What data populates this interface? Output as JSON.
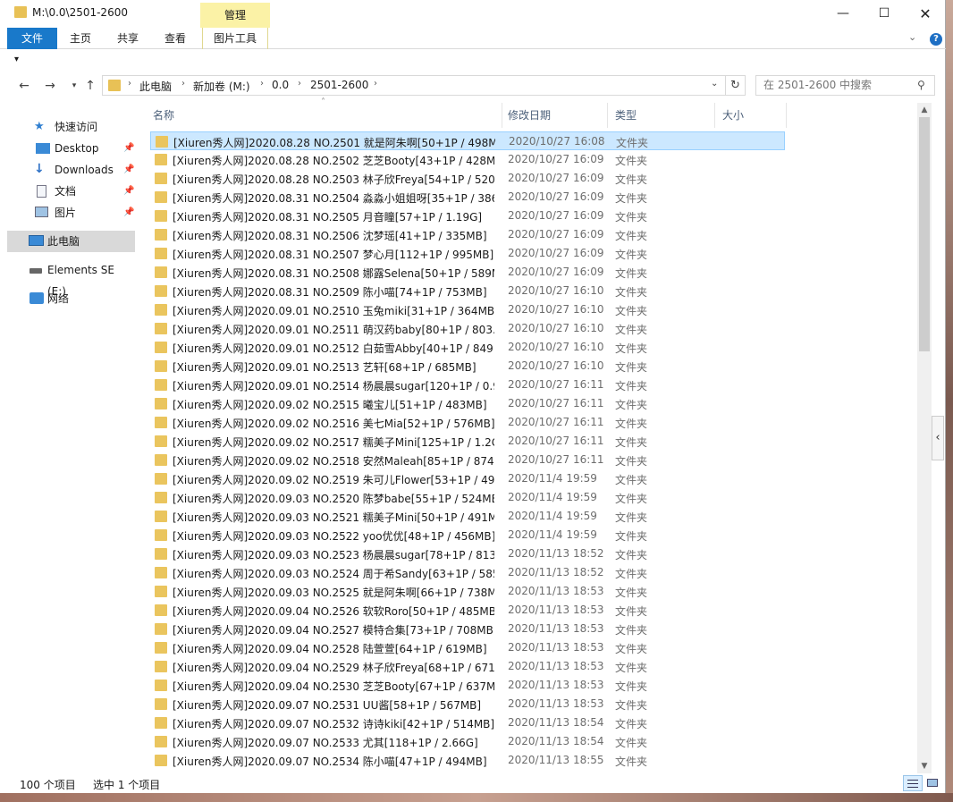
{
  "window": {
    "title": "M:\\0.0\\2501-2600",
    "context_tab": "管理",
    "controls": {
      "minimize": "—",
      "maximize": "☐",
      "close": "✕"
    }
  },
  "ribbon": {
    "tabs": [
      "文件",
      "主页",
      "共享",
      "查看",
      "图片工具"
    ],
    "help": "?",
    "accent": "#1979ca"
  },
  "address": {
    "breadcrumbs": [
      "此电脑",
      "新加卷 (M:)",
      "0.0",
      "2501-2600"
    ]
  },
  "search": {
    "placeholder": "在 2501-2600 中搜索"
  },
  "sidebar": {
    "items": [
      {
        "label": "快速访问",
        "icon": "star-icon",
        "pinned": false
      },
      {
        "label": "Desktop",
        "icon": "desktop-icon",
        "pinned": true
      },
      {
        "label": "Downloads",
        "icon": "download-icon",
        "pinned": true
      },
      {
        "label": "文档",
        "icon": "document-icon",
        "pinned": true
      },
      {
        "label": "图片",
        "icon": "picture-icon",
        "pinned": true
      },
      {
        "label": "此电脑",
        "icon": "computer-icon",
        "pinned": false
      },
      {
        "label": "Elements SE (E:)",
        "icon": "drive-icon",
        "pinned": false
      },
      {
        "label": "网络",
        "icon": "network-icon",
        "pinned": false
      }
    ]
  },
  "columns": [
    "名称",
    "修改日期",
    "类型",
    "大小"
  ],
  "files": [
    {
      "name": "[Xiuren秀人网]2020.08.28 NO.2501 就是阿朱啊[50+1P / 498MB]",
      "date": "2020/10/27 16:08",
      "type": "文件夹"
    },
    {
      "name": "[Xiuren秀人网]2020.08.28 NO.2502 芝芝Booty[43+1P / 428MB]",
      "date": "2020/10/27 16:09",
      "type": "文件夹"
    },
    {
      "name": "[Xiuren秀人网]2020.08.28 NO.2503 林子欣Freya[54+1P / 520...",
      "date": "2020/10/27 16:09",
      "type": "文件夹"
    },
    {
      "name": "[Xiuren秀人网]2020.08.31 NO.2504 淼淼小姐姐呀[35+1P / 386...",
      "date": "2020/10/27 16:09",
      "type": "文件夹"
    },
    {
      "name": "[Xiuren秀人网]2020.08.31 NO.2505 月音瞳[57+1P / 1.19G]",
      "date": "2020/10/27 16:09",
      "type": "文件夹"
    },
    {
      "name": "[Xiuren秀人网]2020.08.31 NO.2506 沈梦瑶[41+1P / 335MB]",
      "date": "2020/10/27 16:09",
      "type": "文件夹"
    },
    {
      "name": "[Xiuren秀人网]2020.08.31 NO.2507 梦心月[112+1P / 995MB]",
      "date": "2020/10/27 16:09",
      "type": "文件夹"
    },
    {
      "name": "[Xiuren秀人网]2020.08.31 NO.2508 娜露Selena[50+1P / 589M...",
      "date": "2020/10/27 16:09",
      "type": "文件夹"
    },
    {
      "name": "[Xiuren秀人网]2020.08.31 NO.2509 陈小喵[74+1P / 753MB]",
      "date": "2020/10/27 16:10",
      "type": "文件夹"
    },
    {
      "name": "[Xiuren秀人网]2020.09.01 NO.2510 玉兔miki[31+1P / 364MB]",
      "date": "2020/10/27 16:10",
      "type": "文件夹"
    },
    {
      "name": "[Xiuren秀人网]2020.09.01 NO.2511 萌汉药baby[80+1P / 803...",
      "date": "2020/10/27 16:10",
      "type": "文件夹"
    },
    {
      "name": "[Xiuren秀人网]2020.09.01 NO.2512 白茹雪Abby[40+1P / 849...",
      "date": "2020/10/27 16:10",
      "type": "文件夹"
    },
    {
      "name": "[Xiuren秀人网]2020.09.01 NO.2513 艺轩[68+1P / 685MB]",
      "date": "2020/10/27 16:10",
      "type": "文件夹"
    },
    {
      "name": "[Xiuren秀人网]2020.09.01 NO.2514 杨晨晨sugar[120+1P / 0.9...",
      "date": "2020/10/27 16:11",
      "type": "文件夹"
    },
    {
      "name": "[Xiuren秀人网]2020.09.02 NO.2515 曦宝儿[51+1P / 483MB]",
      "date": "2020/10/27 16:11",
      "type": "文件夹"
    },
    {
      "name": "[Xiuren秀人网]2020.09.02 NO.2516 美七Mia[52+1P / 576MB]",
      "date": "2020/10/27 16:11",
      "type": "文件夹"
    },
    {
      "name": "[Xiuren秀人网]2020.09.02 NO.2517 糯美子Mini[125+1P / 1.2G]",
      "date": "2020/10/27 16:11",
      "type": "文件夹"
    },
    {
      "name": "[Xiuren秀人网]2020.09.02 NO.2518 安然Maleah[85+1P / 874...",
      "date": "2020/10/27 16:11",
      "type": "文件夹"
    },
    {
      "name": "[Xiuren秀人网]2020.09.02 NO.2519 朱可儿Flower[53+1P / 493...",
      "date": "2020/11/4 19:59",
      "type": "文件夹"
    },
    {
      "name": "[Xiuren秀人网]2020.09.03 NO.2520 陈梦babe[55+1P / 524MB]",
      "date": "2020/11/4 19:59",
      "type": "文件夹"
    },
    {
      "name": "[Xiuren秀人网]2020.09.03 NO.2521 糯美子Mini[50+1P / 491MB]",
      "date": "2020/11/4 19:59",
      "type": "文件夹"
    },
    {
      "name": "[Xiuren秀人网]2020.09.03 NO.2522 yoo优优[48+1P / 456MB]",
      "date": "2020/11/4 19:59",
      "type": "文件夹"
    },
    {
      "name": "[Xiuren秀人网]2020.09.03 NO.2523 杨晨晨sugar[78+1P / 813...",
      "date": "2020/11/13 18:52",
      "type": "文件夹"
    },
    {
      "name": "[Xiuren秀人网]2020.09.03 NO.2524 周于希Sandy[63+1P / 585...",
      "date": "2020/11/13 18:52",
      "type": "文件夹"
    },
    {
      "name": "[Xiuren秀人网]2020.09.03 NO.2525 就是阿朱啊[66+1P / 738MB]",
      "date": "2020/11/13 18:53",
      "type": "文件夹"
    },
    {
      "name": "[Xiuren秀人网]2020.09.04 NO.2526 软软Roro[50+1P / 485MB]",
      "date": "2020/11/13 18:53",
      "type": "文件夹"
    },
    {
      "name": "[Xiuren秀人网]2020.09.04 NO.2527 模特合集[73+1P / 708MB]",
      "date": "2020/11/13 18:53",
      "type": "文件夹"
    },
    {
      "name": "[Xiuren秀人网]2020.09.04 NO.2528 陆萱萱[64+1P / 619MB]",
      "date": "2020/11/13 18:53",
      "type": "文件夹"
    },
    {
      "name": "[Xiuren秀人网]2020.09.04 NO.2529 林子欣Freya[68+1P / 671...",
      "date": "2020/11/13 18:53",
      "type": "文件夹"
    },
    {
      "name": "[Xiuren秀人网]2020.09.04 NO.2530 芝芝Booty[67+1P / 637MB]",
      "date": "2020/11/13 18:53",
      "type": "文件夹"
    },
    {
      "name": "[Xiuren秀人网]2020.09.07 NO.2531 UU酱[58+1P / 567MB]",
      "date": "2020/11/13 18:53",
      "type": "文件夹"
    },
    {
      "name": "[Xiuren秀人网]2020.09.07 NO.2532 诗诗kiki[42+1P / 514MB]",
      "date": "2020/11/13 18:54",
      "type": "文件夹"
    },
    {
      "name": "[Xiuren秀人网]2020.09.07 NO.2533 尤其[118+1P / 2.66G]",
      "date": "2020/11/13 18:54",
      "type": "文件夹"
    },
    {
      "name": "[Xiuren秀人网]2020.09.07 NO.2534 陈小喵[47+1P / 494MB]",
      "date": "2020/11/13 18:55",
      "type": "文件夹"
    }
  ],
  "selected_index": 0,
  "status": {
    "count": "100 个项目",
    "selected": "选中 1 个项目"
  },
  "colors": {
    "folder": "#eac55e",
    "selection": "#cce8ff",
    "manage_tab": "#fbf2a6"
  }
}
